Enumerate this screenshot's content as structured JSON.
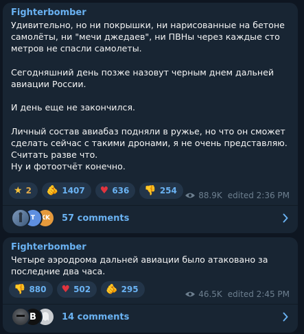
{
  "posts": [
    {
      "author": "Fighterbomber",
      "paragraphs": [
        "Удивительно, но ни покрышки, ни нарисованные на бетоне самолёты, ни \"мечи джедаев\", ни ПВНы через каждые сто метров не спасли самолеты.",
        "Сегодняшний день позже назовут черным днем дальней авиации России.",
        "И день еще не закончился.",
        "Личный состав авиабаз подняли в ружье, но что он сможет сделать сейчас с такими дронами, я не очень представляю. Считать разве что.\nНу и фотоотчёт конечно."
      ],
      "reactions": [
        {
          "icon": "star-icon",
          "glyph": "★",
          "count": "2"
        },
        {
          "icon": "pointing-hand-icon",
          "glyph": "🫵",
          "count": "1407"
        },
        {
          "icon": "heart-icon",
          "glyph": "♥",
          "count": "636"
        },
        {
          "icon": "thumbs-down-icon",
          "glyph": "👎",
          "count": "254"
        }
      ],
      "views": "88.9K",
      "edited": "edited 2:36 PM",
      "comments": "57 comments",
      "commenter_initials": [
        "",
        "T",
        "KK"
      ],
      "commenter_colors": [
        "#5a7ea8",
        "#5e8fe0",
        "#e69a3c"
      ]
    },
    {
      "author": "Fighterbomber",
      "paragraphs": [
        "Четыре аэродрома дальней авиации было атаковано за последние два часа."
      ],
      "reactions": [
        {
          "icon": "thumbs-down-icon",
          "glyph": "👎",
          "count": "880"
        },
        {
          "icon": "heart-icon",
          "glyph": "♥",
          "count": "502"
        },
        {
          "icon": "pointing-hand-icon",
          "glyph": "🫵",
          "count": "295"
        }
      ],
      "views": "46.5K",
      "edited": "edited 2:45 PM",
      "comments": "14 comments",
      "commenter_initials": [
        "",
        "B",
        ""
      ],
      "commenter_colors": [
        "#3a3f44",
        "#111111",
        "#c9ccd0"
      ]
    }
  ],
  "colors": {
    "background": "#0e1621",
    "bubble": "#182533",
    "accent": "#6ab2f2",
    "meta": "#6d7f8f"
  }
}
